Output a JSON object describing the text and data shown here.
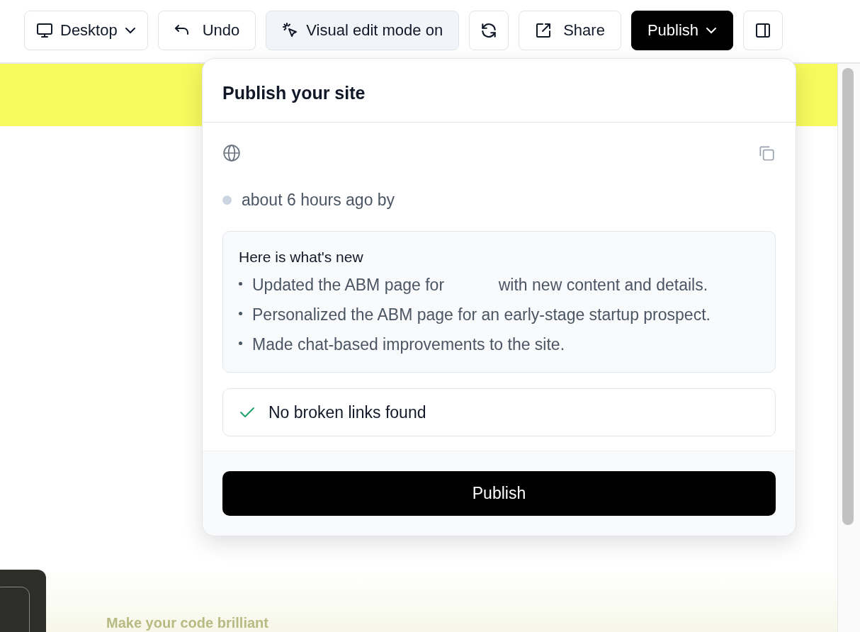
{
  "toolbar": {
    "device": {
      "label": "Desktop"
    },
    "undo": {
      "label": "Undo"
    },
    "visual_edit": {
      "label": "Visual edit mode on",
      "on": true
    },
    "share": {
      "label": "Share"
    },
    "publish": {
      "label": "Publish"
    }
  },
  "preview": {
    "headline": "Make your code brilliant"
  },
  "publish_popover": {
    "title": "Publish your site",
    "last_published": "about 6 hours ago by",
    "changes": {
      "heading": "Here is what's new",
      "items": [
        "Updated the ABM page for            with new content and details.",
        "Personalized the ABM page for an early-stage startup prospect.",
        "Made chat-based improvements to the site."
      ]
    },
    "link_check": {
      "label": "No broken links found",
      "passed": true
    },
    "button": "Publish"
  }
}
